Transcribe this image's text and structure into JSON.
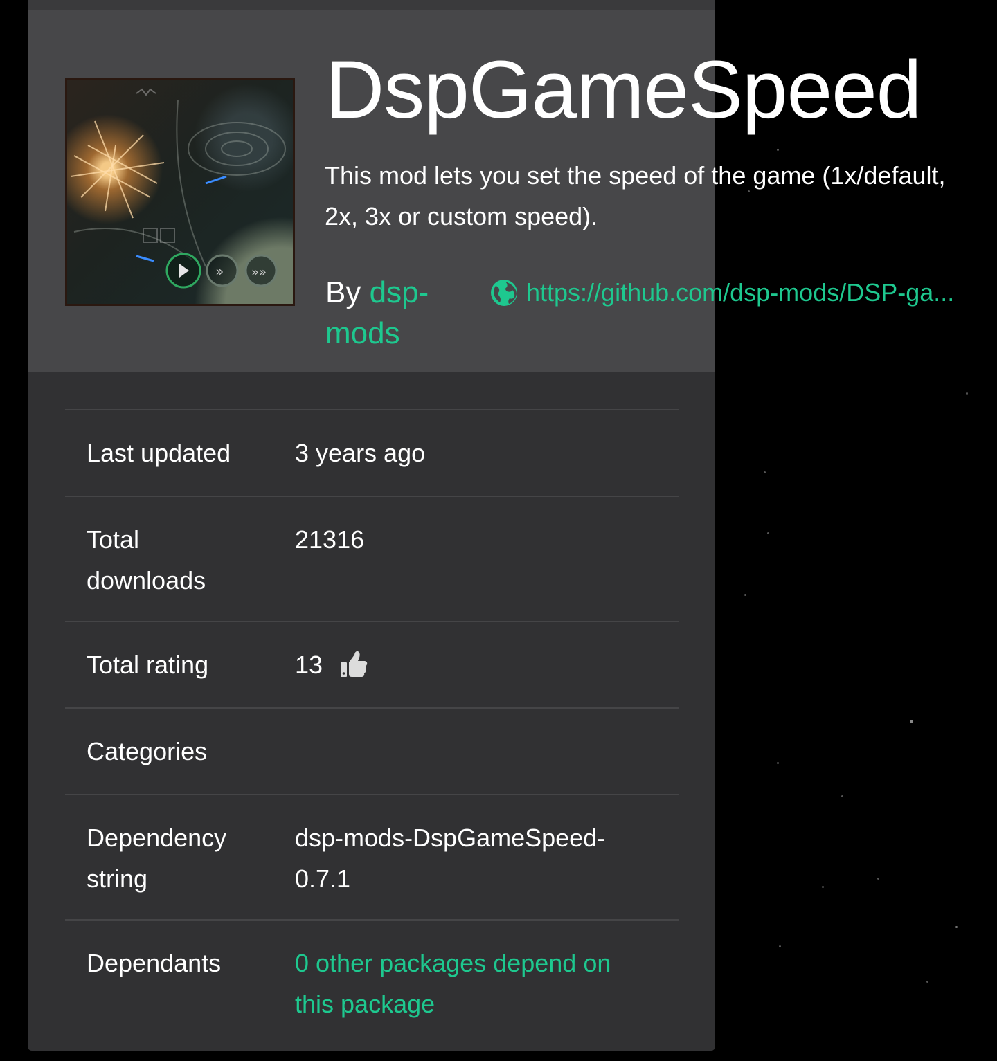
{
  "package": {
    "title": "DspGameSpeed",
    "description": "This mod lets you set the speed of the game (1x/default, 2x, 3x or custom speed).",
    "by_label": "By",
    "author": "dsp-mods",
    "website_url": "https://github.com/dsp-mods/DSP-ga..."
  },
  "details": {
    "last_updated": {
      "label": "Last updated",
      "value": "3 years ago"
    },
    "total_downloads": {
      "label": "Total downloads",
      "value": "21316"
    },
    "total_rating": {
      "label": "Total rating",
      "value": "13"
    },
    "categories": {
      "label": "Categories",
      "value": ""
    },
    "dependency_string": {
      "label": "Dependency string",
      "value": "dsp-mods-DspGameSpeed-0.7.1"
    },
    "dependants": {
      "label": "Dependants",
      "value": "0 other packages depend on this package"
    }
  },
  "icons": {
    "website": "globe-icon",
    "rating": "thumbs-up-icon"
  },
  "colors": {
    "accent": "#1ec88f",
    "card_bg": "#313133",
    "header_bg": "#474749",
    "page_bg": "#000000",
    "text": "#ffffff"
  }
}
